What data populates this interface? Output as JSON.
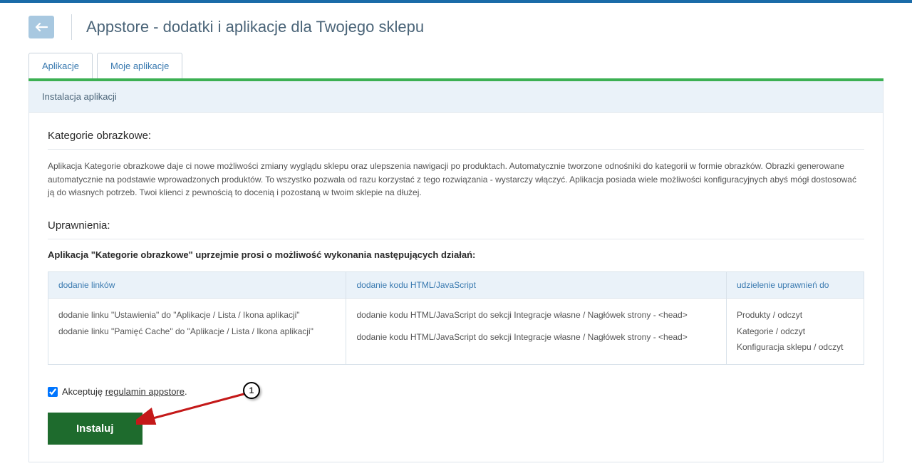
{
  "page_title": "Appstore - dodatki i aplikacje dla Twojego sklepu",
  "tabs": {
    "applications": "Aplikacje",
    "my_applications": "Moje aplikacje"
  },
  "panel_header": "Instalacja aplikacji",
  "section_title": "Kategorie obrazkowe:",
  "description": "Aplikacja Kategorie obrazkowe daje ci nowe możliwości zmiany wyglądu sklepu oraz ulepszenia nawigacji po produktach. Automatycznie tworzone odnośniki do kategorii w formie obrazków. Obrazki generowane automatycznie na podstawie wprowadzonych produktów. To wszystko pozwala od razu korzystać z tego rozwiązania - wystarczy włączyć. Aplikacja posiada wiele możliwości konfiguracyjnych abyś mógł dostosować ją do własnych potrzeb. Twoi klienci z pewnością to docenią i pozostaną w twoim sklepie na dłużej.",
  "permissions_title": "Uprawnienia:",
  "permissions_intro": "Aplikacja \"Kategorie obrazkowe\" uprzejmie prosi o możliwość wykonania następujących działań:",
  "table": {
    "headers": {
      "col1": "dodanie linków",
      "col2": "dodanie kodu HTML/JavaScript",
      "col3": "udzielenie uprawnień do"
    },
    "col1_row1": "dodanie linku \"Ustawienia\" do \"Aplikacje / Lista / Ikona aplikacji\"",
    "col1_row2": "dodanie linku \"Pamięć Cache\" do \"Aplikacje / Lista / Ikona aplikacji\"",
    "col2_row1": "dodanie kodu HTML/JavaScript do sekcji Integracje własne / Nagłówek strony - <head>",
    "col2_row2": "dodanie kodu HTML/JavaScript do sekcji Integracje własne / Nagłówek strony - <head>",
    "col3_row1": "Produkty / odczyt",
    "col3_row2": "Kategorie / odczyt",
    "col3_row3": "Konfiguracja sklepu / odczyt"
  },
  "accept_prefix": "Akceptuję ",
  "accept_link": "regulamin appstore",
  "accept_suffix": ".",
  "install_button": "Instaluj",
  "annotation_number": "1"
}
